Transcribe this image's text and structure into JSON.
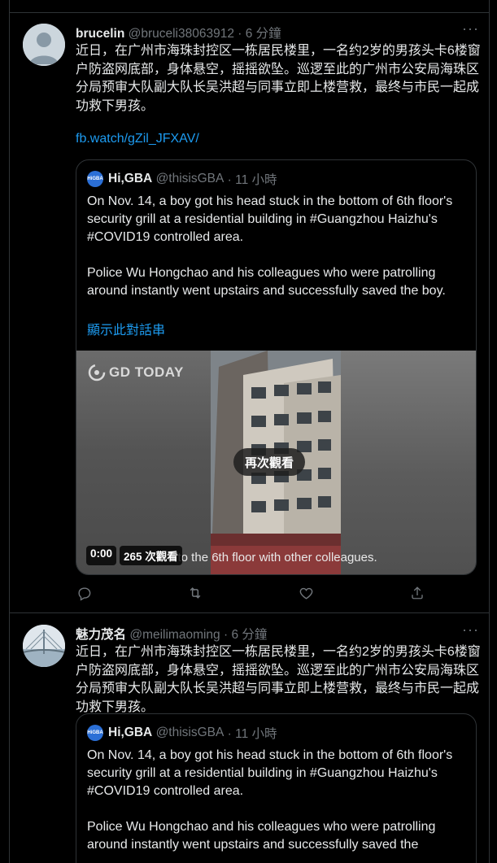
{
  "tweets": [
    {
      "name": "brucelin",
      "handle": "@bruceli38063912",
      "time": "· 6 分鐘",
      "text": "近日，在广州市海珠封控区一栋居民楼里，一名约2岁的男孩头卡6楼窗户防盗网底部，身体悬空，摇摇欲坠。巡逻至此的广州市公安局海珠区分局预审大队副大队长吴洪超与同事立即上楼营救，最终与市民一起成功救下男孩。",
      "link": "fb.watch/gZil_JFXAV/",
      "quote": {
        "name": "Hi,GBA",
        "handle": "@thisisGBA",
        "time": "· 11 小時",
        "para1": "On Nov. 14, a boy got his head stuck in the bottom of 6th floor's security grill at a residential building in #Guangzhou Haizhu's #COVID19 controlled area.",
        "para2": "Police Wu Hongchao and his colleagues who were patrolling around instantly went upstairs and successfully saved the boy.",
        "show_thread": "顯示此對話串",
        "media": {
          "watermark": "GD TODAY",
          "replay": "再次觀看",
          "caption": "d to the 6th floor with other colleagues.",
          "time": "0:00",
          "views": "265 次觀看"
        }
      }
    },
    {
      "name": "魅力茂名",
      "handle": "@meilimaoming",
      "time": "· 6 分鐘",
      "text": "近日，在广州市海珠封控区一栋居民楼里，一名约2岁的男孩头卡6楼窗户防盗网底部，身体悬空，摇摇欲坠。巡逻至此的广州市公安局海珠区分局预审大队副大队长吴洪超与同事立即上楼营救，最终与市民一起成功救下男孩。",
      "quote": {
        "name": "Hi,GBA",
        "handle": "@thisisGBA",
        "time": "· 11 小時",
        "para1": "On Nov. 14, a boy got his head stuck in the bottom of 6th floor's security grill at a residential building in #Guangzhou Haizhu's #COVID19 controlled area.",
        "para2": "Police Wu Hongchao and his colleagues who were patrolling around instantly went upstairs and successfully saved the"
      }
    }
  ],
  "more_label": "···",
  "quote_avatar_text": "HiGBA",
  "colors": {
    "accent": "#1d9bf0",
    "muted": "#71767b",
    "border": "#2f3336"
  }
}
